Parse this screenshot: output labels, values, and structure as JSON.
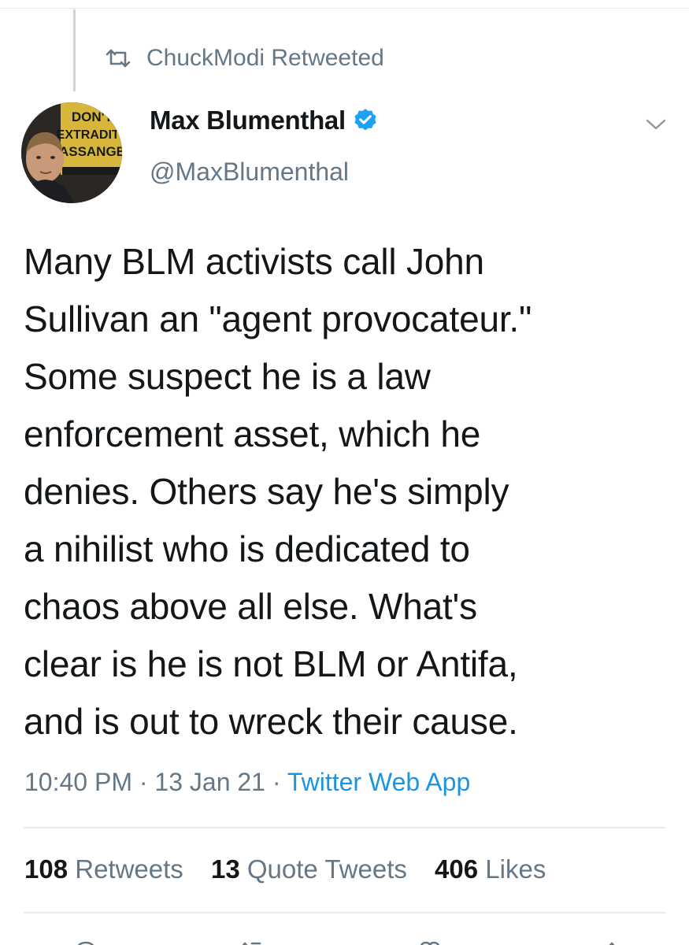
{
  "retweet_context": {
    "icon": "retweet-icon",
    "text": "ChuckModi Retweeted"
  },
  "author": {
    "display_name": "Max Blumenthal",
    "handle": "@MaxBlumenthal",
    "verified": true,
    "avatar_sign_lines": [
      "DON'T",
      "EXTRADITE",
      "ASSANGE"
    ]
  },
  "tweet": {
    "text_lines": [
      "Many BLM activists call John",
      "Sullivan an \"agent provocateur.\"",
      "Some suspect he is a law",
      "enforcement asset, which he",
      "denies. Others say he's simply",
      "a nihilist who is dedicated to",
      "chaos above all else. What's",
      "clear is he is not BLM or Antifa,",
      "and is out to wreck their cause."
    ],
    "time": "10:40 PM",
    "date": "13 Jan 21",
    "source": "Twitter Web App",
    "separator": "·"
  },
  "stats": {
    "retweets_count": "108",
    "retweets_label": "Retweets",
    "quotes_count": "13",
    "quotes_label": "Quote Tweets",
    "likes_count": "406",
    "likes_label": "Likes"
  },
  "colors": {
    "text_primary": "#14171a",
    "text_secondary": "#657786",
    "link": "#1b95e0",
    "verified_badge": "#1da1f2",
    "divider": "#e6ecf0"
  },
  "icons": {
    "retweet": "retweet-icon",
    "verified": "verified-badge-icon",
    "more": "chevron-down-icon",
    "reply": "reply-icon",
    "retweet_action": "retweet-action-icon",
    "like": "heart-icon",
    "share": "share-icon"
  }
}
